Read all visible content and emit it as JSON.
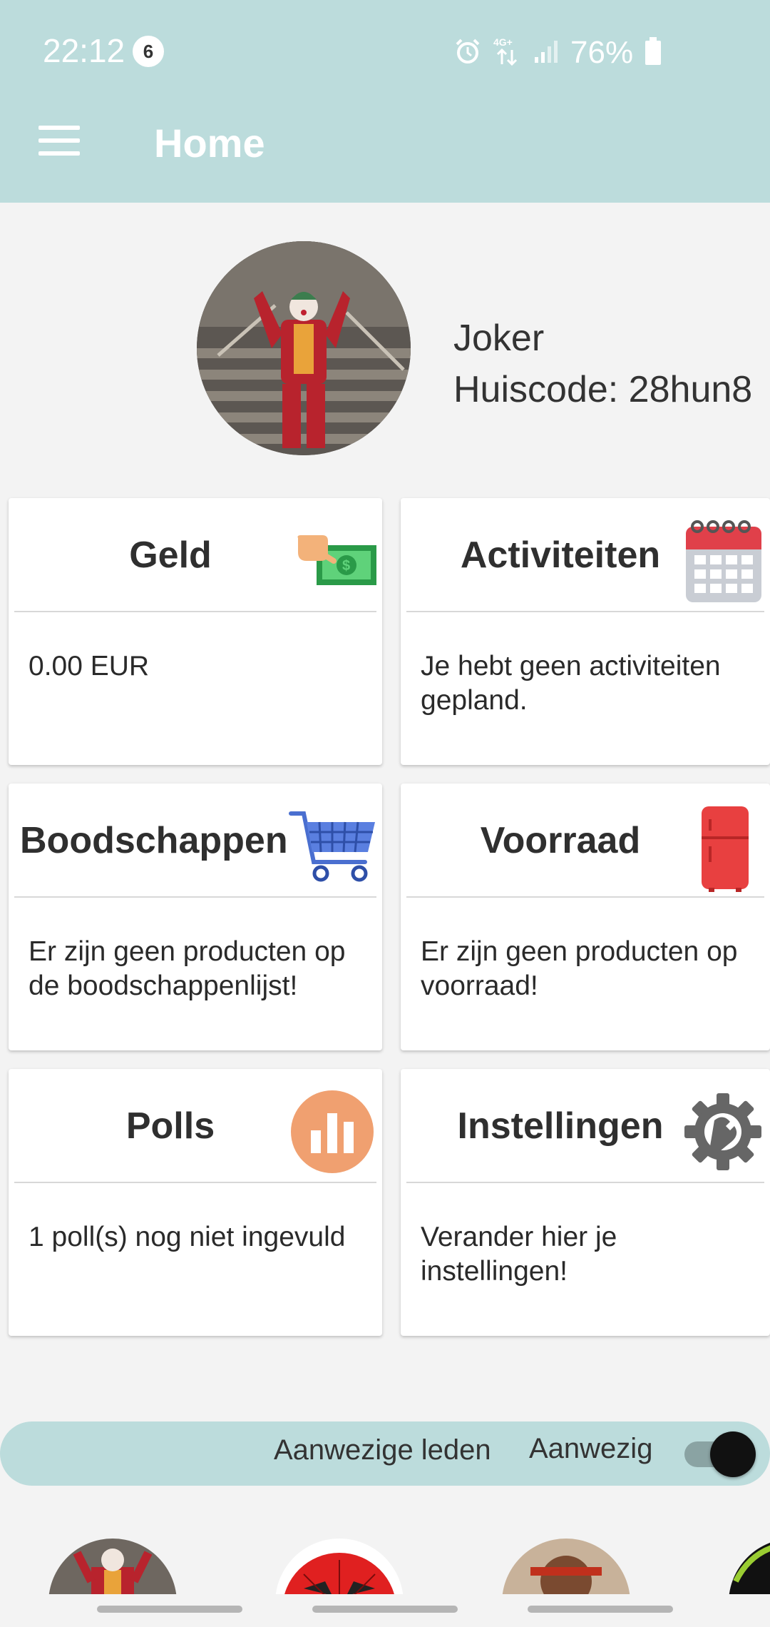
{
  "status_bar": {
    "time": "22:12",
    "notification_count": "6",
    "network": "4G+",
    "battery": "76%"
  },
  "app_bar": {
    "title": "Home",
    "menu_icon": "hamburger-menu-icon"
  },
  "profile": {
    "name": "Joker",
    "house_code": "Huiscode: 28hun8"
  },
  "cards": {
    "geld": {
      "title": "Geld",
      "body": "0.00 EUR",
      "icon": "money-icon"
    },
    "activiteiten": {
      "title": "Activiteiten",
      "body": "Je hebt geen activiteiten gepland.",
      "icon": "calendar-icon"
    },
    "boodschappen": {
      "title": "Boodschappen",
      "body": "Er zijn geen producten op de boodschappenlijst!",
      "icon": "shopping-cart-icon"
    },
    "voorraad": {
      "title": "Voorraad",
      "body": "Er zijn geen producten op voorraad!",
      "icon": "fridge-icon"
    },
    "polls": {
      "title": "Polls",
      "body": "1 poll(s) nog niet ingevuld",
      "icon": "poll-chart-icon"
    },
    "instellingen": {
      "title": "Instellingen",
      "body": "Verander hier je instellingen!",
      "icon": "gear-wrench-icon"
    }
  },
  "members": {
    "label": "Aanwezige leden",
    "toggle_label": "Aanwezig",
    "toggle_on": true
  },
  "colors": {
    "accent": "#bcdcdc",
    "background": "#f3f3f3",
    "poll_orange": "#f0a070",
    "cart_blue": "#4a6fd0",
    "fridge_red": "#e84040",
    "calendar_red": "#e0404a"
  }
}
